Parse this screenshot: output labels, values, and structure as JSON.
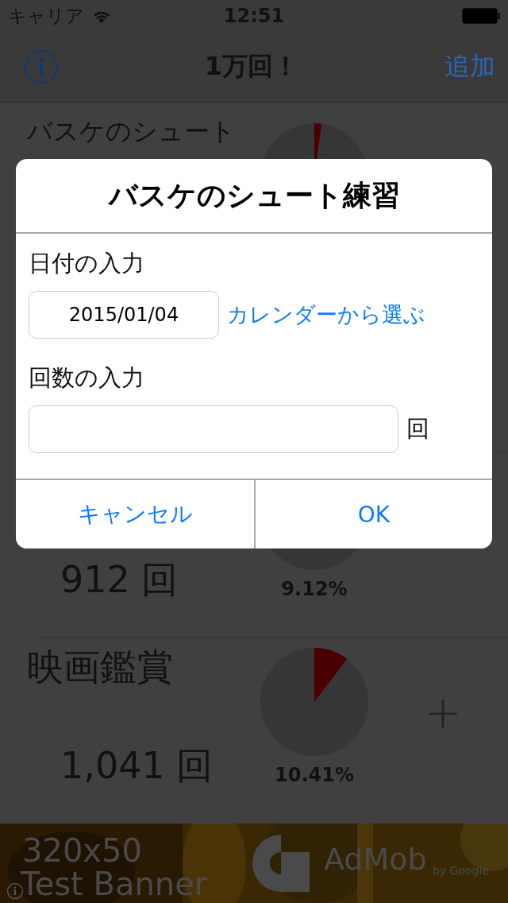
{
  "status_bar": {
    "carrier": "キャリア",
    "time": "12:51"
  },
  "nav_bar": {
    "title": "1万回！",
    "add_button": "追加"
  },
  "rows": [
    {
      "name": "バスケのシュート"
    },
    {
      "count": "912 回",
      "percent": "9.12%"
    },
    {
      "name": "映画鑑賞",
      "count": "1,041 回",
      "percent": "10.41%",
      "plus": "+"
    }
  ],
  "dialog": {
    "title": "バスケのシュート練習",
    "date_label": "日付の入力",
    "date_value": "2015/01/04",
    "calendar_link": "カレンダーから選ぶ",
    "count_label": "回数の入力",
    "count_unit": "回",
    "buttons": [
      "キャンセル",
      "OK"
    ]
  },
  "ad_banner": {
    "size": "320x50",
    "label": "Test Banner",
    "brand": "AdMob",
    "brand_sub": "by Google"
  }
}
